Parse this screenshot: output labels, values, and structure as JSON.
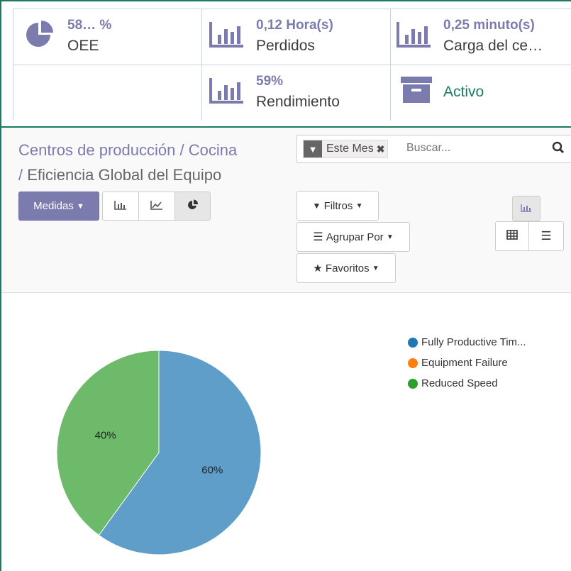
{
  "stats": {
    "oee": {
      "value": "58… %",
      "label": "OEE"
    },
    "lost": {
      "value": "0,12 Hora(s)",
      "label": "Perdidos"
    },
    "load": {
      "value": "0,25 minuto(s)",
      "label": "Carga del ce…"
    },
    "performance": {
      "value": "59%",
      "label": "Rendimiento"
    },
    "active": {
      "label": "Activo"
    }
  },
  "breadcrumb": {
    "item1": "Centros de producción",
    "item2": "Cocina",
    "current": "Eficiencia Global del Equipo"
  },
  "search": {
    "facet": "Este Mes",
    "placeholder": "Buscar..."
  },
  "toolbar": {
    "measures": "Medidas",
    "filters": "Filtros",
    "group_by": "Agrupar Por",
    "favorites": "Favoritos"
  },
  "chart_data": {
    "type": "pie",
    "categories": [
      "Fully Productive Tim...",
      "Equipment Failure",
      "Reduced Speed"
    ],
    "values": [
      60,
      0,
      40
    ],
    "labels": [
      "60%",
      "",
      "40%"
    ],
    "colors": [
      "#5f9ec9",
      "#ff7f0e",
      "#6dbb6a"
    ],
    "legend_colors": [
      "#1f77b4",
      "#ff7f0e",
      "#2ca02c"
    ],
    "legend": "top-right"
  }
}
